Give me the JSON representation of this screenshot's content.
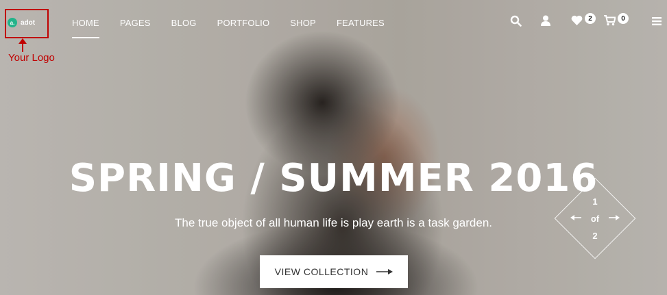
{
  "logo": {
    "mark": "a.",
    "name": "adot"
  },
  "annotation": {
    "label": "Your Logo",
    "color": "#c00000"
  },
  "nav": {
    "items": [
      {
        "label": "HOME",
        "active": true
      },
      {
        "label": "PAGES"
      },
      {
        "label": "BLOG"
      },
      {
        "label": "PORTFOLIO"
      },
      {
        "label": "SHOP"
      },
      {
        "label": "FEATURES"
      }
    ]
  },
  "header_icons": {
    "search": "search-icon",
    "account": "user-icon",
    "wishlist": {
      "icon": "heart-icon",
      "count": "2"
    },
    "cart": {
      "icon": "cart-icon",
      "count": "0"
    },
    "menu": "hamburger-menu-icon"
  },
  "hero": {
    "headline": "SPRING / SUMMER 2016",
    "tagline": "The true object of all human life is play earth is a task garden.",
    "cta_label": "VIEW COLLECTION"
  },
  "slider": {
    "current": "1",
    "of_label": "of",
    "total": "2"
  },
  "colors": {
    "accent": "#23b38a",
    "annotation": "#c00000",
    "text": "#ffffff"
  }
}
